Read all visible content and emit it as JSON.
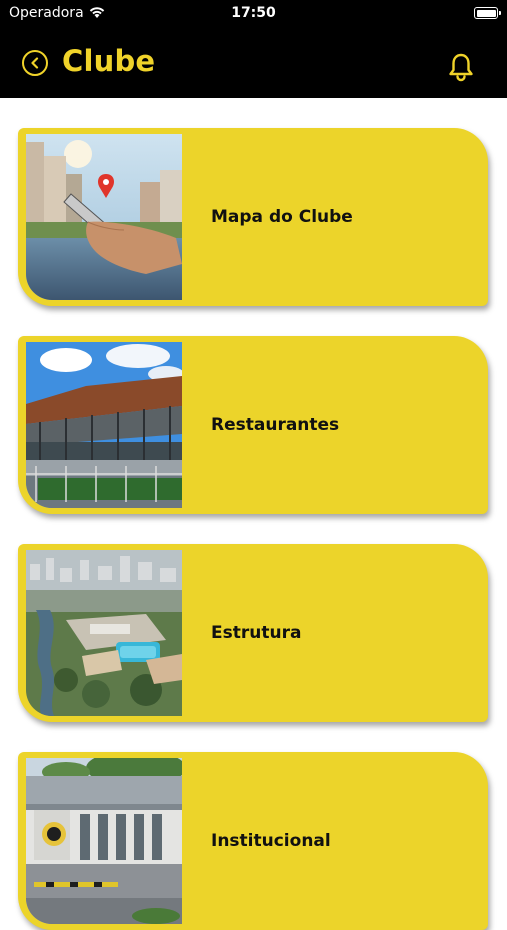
{
  "status_bar": {
    "carrier": "Operadora",
    "time": "17:50"
  },
  "header": {
    "title": "Clube"
  },
  "menu": [
    {
      "label": "Mapa do Clube"
    },
    {
      "label": "Restaurantes"
    },
    {
      "label": "Estrutura"
    },
    {
      "label": "Institucional"
    }
  ],
  "colors": {
    "accent": "#f0d32a",
    "card": "#ecd42a",
    "nav_bg": "#000000"
  }
}
